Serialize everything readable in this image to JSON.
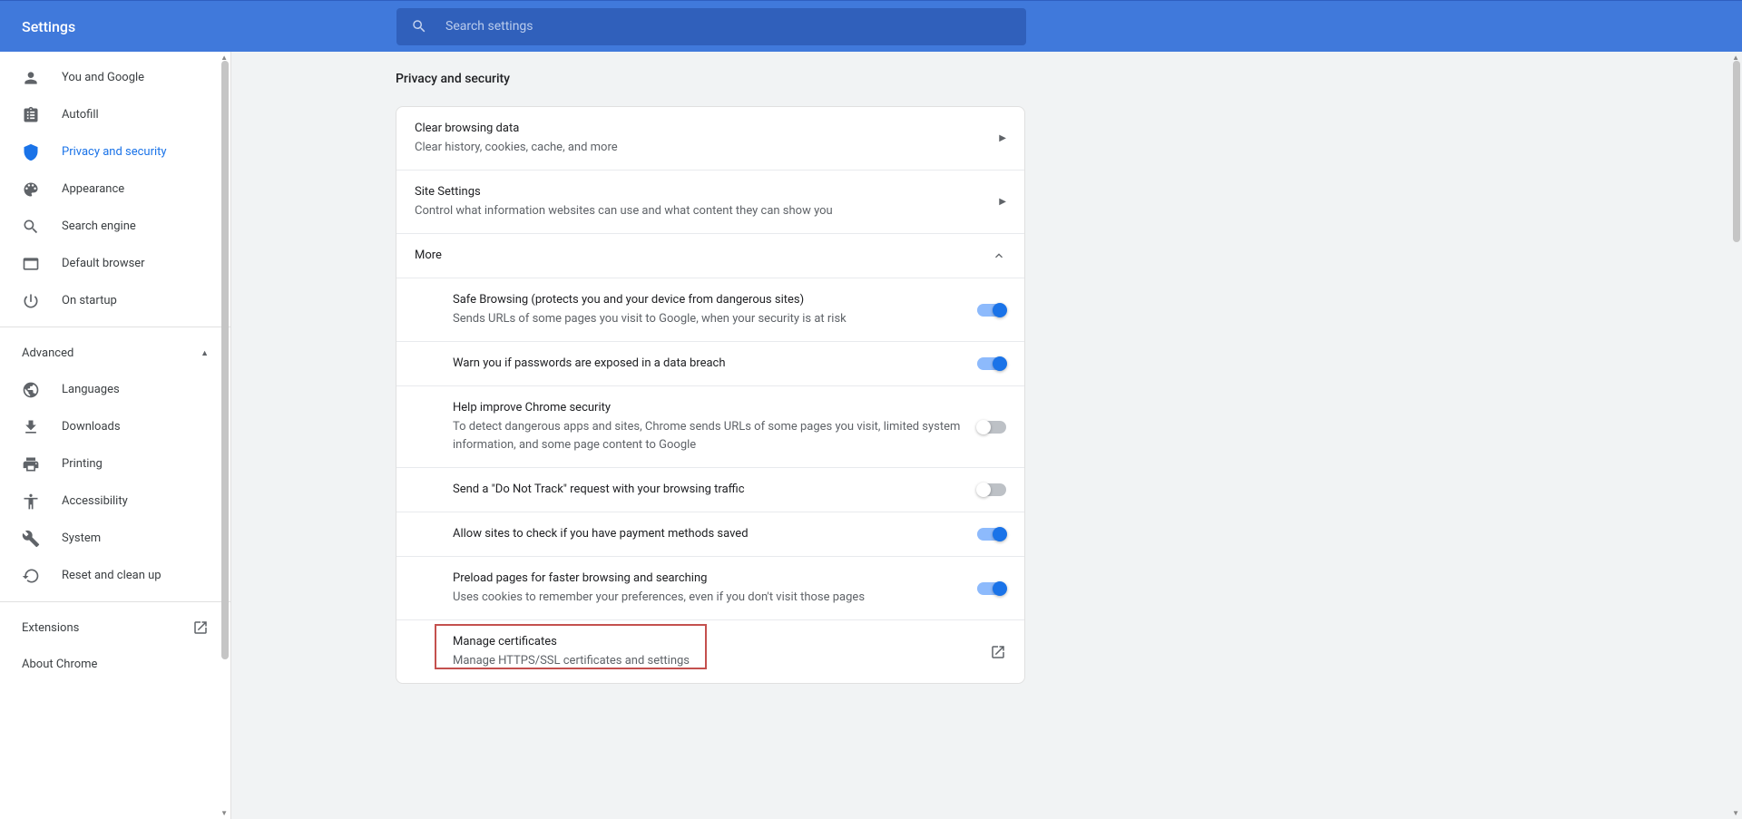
{
  "header": {
    "title": "Settings",
    "search_placeholder": "Search settings"
  },
  "sidebar": {
    "items": [
      {
        "label": "You and Google"
      },
      {
        "label": "Autofill"
      },
      {
        "label": "Privacy and security"
      },
      {
        "label": "Appearance"
      },
      {
        "label": "Search engine"
      },
      {
        "label": "Default browser"
      },
      {
        "label": "On startup"
      }
    ],
    "advanced_label": "Advanced",
    "advanced_items": [
      {
        "label": "Languages"
      },
      {
        "label": "Downloads"
      },
      {
        "label": "Printing"
      },
      {
        "label": "Accessibility"
      },
      {
        "label": "System"
      },
      {
        "label": "Reset and clean up"
      }
    ],
    "extensions_label": "Extensions",
    "about_label": "About Chrome"
  },
  "main": {
    "page_title": "Privacy and security",
    "rows": {
      "clear": {
        "title": "Clear browsing data",
        "sub": "Clear history, cookies, cache, and more"
      },
      "site": {
        "title": "Site Settings",
        "sub": "Control what information websites can use and what content they can show you"
      },
      "more": {
        "title": "More"
      },
      "safe": {
        "title": "Safe Browsing (protects you and your device from dangerous sites)",
        "sub": "Sends URLs of some pages you visit to Google, when your security is at risk"
      },
      "warn": {
        "title": "Warn you if passwords are exposed in a data breach"
      },
      "help": {
        "title": "Help improve Chrome security",
        "sub": "To detect dangerous apps and sites, Chrome sends URLs of some pages you visit, limited system information, and some page content to Google"
      },
      "dnt": {
        "title": "Send a \"Do Not Track\" request with your browsing traffic"
      },
      "payment": {
        "title": "Allow sites to check if you have payment methods saved"
      },
      "preload": {
        "title": "Preload pages for faster browsing and searching",
        "sub": "Uses cookies to remember your preferences, even if you don't visit those pages"
      },
      "cert": {
        "title": "Manage certificates",
        "sub": "Manage HTTPS/SSL certificates and settings"
      }
    }
  }
}
